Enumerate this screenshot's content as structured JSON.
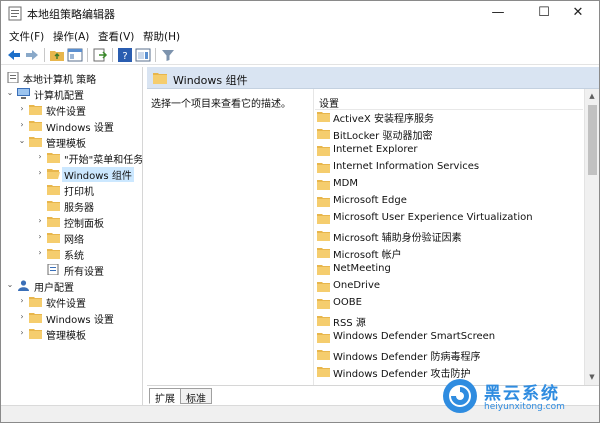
{
  "window": {
    "title": "本地组策略编辑器"
  },
  "titlebar_buttons": {
    "minimize": "—",
    "maximize": "☐",
    "close": "✕"
  },
  "menu": [
    "文件(F)",
    "操作(A)",
    "查看(V)",
    "帮助(H)"
  ],
  "tree": [
    {
      "label": "本地计算机 策略",
      "expander": "",
      "icon": "policy-icon"
    },
    {
      "label": "计算机配置",
      "expander": "⌄",
      "icon": "computer-icon"
    },
    {
      "label": "软件设置",
      "expander": "›",
      "icon": "folder-icon"
    },
    {
      "label": "Windows 设置",
      "expander": "›",
      "icon": "folder-icon"
    },
    {
      "label": "管理模板",
      "expander": "⌄",
      "icon": "folder-icon"
    },
    {
      "label": "\"开始\"菜单和任务",
      "expander": "›",
      "icon": "folder-icon"
    },
    {
      "label": "Windows 组件",
      "expander": "›",
      "icon": "folder-icon",
      "selected": true
    },
    {
      "label": "打印机",
      "expander": "",
      "icon": "folder-icon"
    },
    {
      "label": "服务器",
      "expander": "",
      "icon": "folder-icon"
    },
    {
      "label": "控制面板",
      "expander": "›",
      "icon": "folder-icon"
    },
    {
      "label": "网络",
      "expander": "›",
      "icon": "folder-icon"
    },
    {
      "label": "系统",
      "expander": "›",
      "icon": "folder-icon"
    },
    {
      "label": "所有设置",
      "expander": "",
      "icon": "settings-icon"
    },
    {
      "label": "用户配置",
      "expander": "⌄",
      "icon": "user-icon"
    },
    {
      "label": "软件设置",
      "expander": "›",
      "icon": "folder-icon"
    },
    {
      "label": "Windows 设置",
      "expander": "›",
      "icon": "folder-icon"
    },
    {
      "label": "管理模板",
      "expander": "›",
      "icon": "folder-icon"
    }
  ],
  "right_pane": {
    "header": "Windows 组件",
    "description": "选择一个项目来查看它的描述。",
    "column_header": "设置",
    "items": [
      "ActiveX 安装程序服务",
      "BitLocker 驱动器加密",
      "Internet Explorer",
      "Internet Information Services",
      "MDM",
      "Microsoft Edge",
      "Microsoft User Experience Virtualization",
      "Microsoft 辅助身份验证因素",
      "Microsoft 帐户",
      "NetMeeting",
      "OneDrive",
      "OOBE",
      "RSS 源",
      "Windows Defender SmartScreen",
      "Windows Defender 防病毒程序",
      "Windows Defender 攻击防护"
    ]
  },
  "tabs": {
    "extended": "扩展",
    "standard": "标准"
  },
  "scrollbar": {
    "up": "▲",
    "down": "▼"
  },
  "watermark": {
    "title": "黑云系统",
    "subtitle": "heiyunxitong.com"
  },
  "colors": {
    "accent": "#2f8ce0",
    "header_bg": "#d9e4f2",
    "selection": "#cce8ff",
    "folder": "#e8b64c"
  }
}
